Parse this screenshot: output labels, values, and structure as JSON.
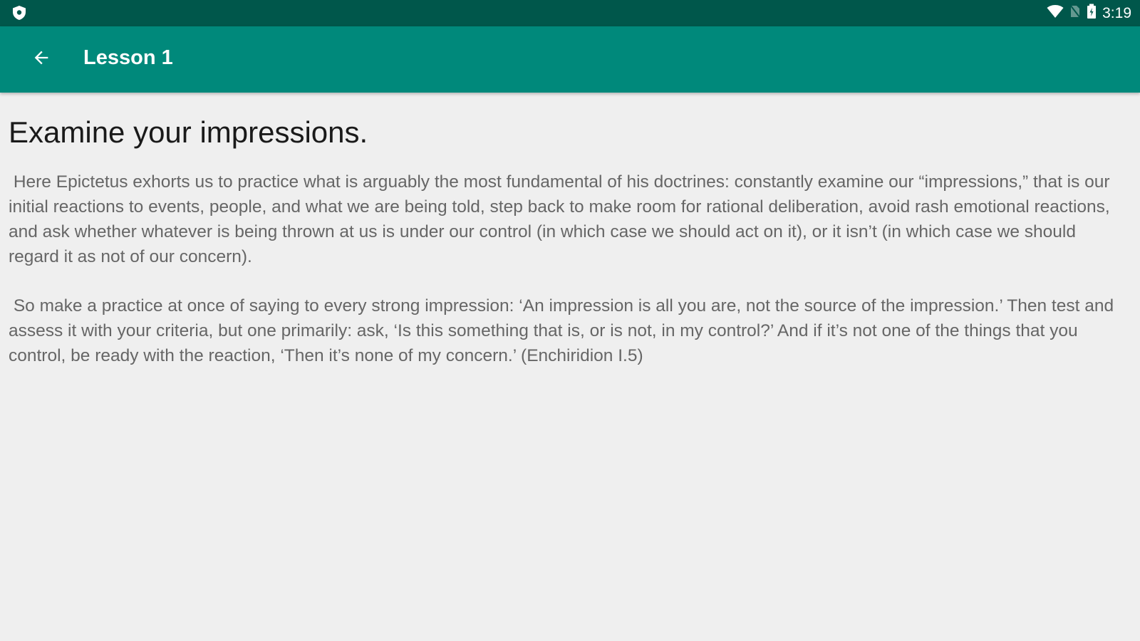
{
  "status_bar": {
    "left_icon": "shield-icon",
    "icons": [
      "wifi-icon",
      "no-sim-icon",
      "battery-icon"
    ],
    "time": "3:19"
  },
  "app_bar": {
    "back_icon": "arrow-back-icon",
    "title": "Lesson 1"
  },
  "lesson": {
    "heading": "Examine your impressions.",
    "paragraphs": [
      " Here Epictetus exhorts us to practice what is arguably the most fundamental of his doctrines: constantly examine our “impressions,” that is our initial reactions to events, people, and what we are being told, step back to make room for rational deliberation, avoid rash emotional reactions, and ask whether whatever is being thrown at us is under our control (in which case we should act on it), or it isn’t (in which case we should regard it as not of our concern).",
      " So make a practice at once of saying to every strong impression: ‘An impression is all you are, not the source of the impression.’ Then test and assess it with your criteria, but one primarily: ask, ‘Is this something that is, or is not, in my control?’ And if it’s not one of the things that you control, be ready with the reaction, ‘Then it’s none of my concern.’ (Enchiridion I.5)"
    ]
  },
  "colors": {
    "status_bar": "#00574b",
    "app_bar": "#00897b",
    "background": "#efefef",
    "heading_text": "#1a1a1a",
    "body_text": "#666666"
  }
}
